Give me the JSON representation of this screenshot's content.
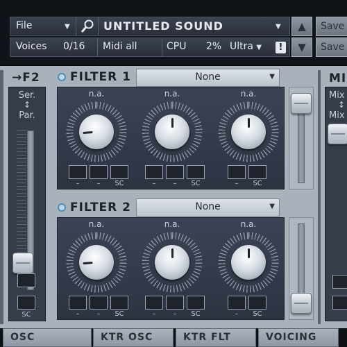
{
  "topbar": {
    "file_label": "File",
    "sound_name": "UNTITLED SOUND",
    "voices_label": "Voices",
    "voices_value": "0/16",
    "midi_label": "Midi all",
    "cpu_label": "CPU",
    "cpu_value": "2%",
    "quality_label": "Ultra",
    "warning_glyph": "!",
    "save_label": "Save",
    "save_label_2": "Save"
  },
  "f2panel": {
    "title": "→F2",
    "ser_label": "Ser.",
    "arrow": "↕",
    "par_label": "Par.",
    "sc_label": "SC",
    "level": 0.12
  },
  "filters": [
    {
      "title": "FILTER 1",
      "type": "None",
      "knobs": [
        {
          "label": "n.a.",
          "value": 0.15
        },
        {
          "label": "n.a.",
          "value": 0.5
        },
        {
          "label": "n.a.",
          "value": 0.5
        }
      ],
      "subs": [
        "–",
        "–",
        "SC",
        "–",
        "–",
        "SC",
        "–",
        "SC"
      ],
      "level": 0.95
    },
    {
      "title": "FILTER 2",
      "type": "None",
      "knobs": [
        {
          "label": "n.a.",
          "value": 0.15
        },
        {
          "label": "n.a.",
          "value": 0.5
        },
        {
          "label": "n.a.",
          "value": 0.5
        }
      ],
      "subs": [
        "–",
        "–",
        "SC",
        "–",
        "–",
        "SC",
        "–",
        "SC"
      ],
      "level": 0.05
    }
  ],
  "mixpanel": {
    "title": "MI",
    "mix_top": "Mix",
    "arrow": "↕",
    "mix_bottom": "Mix"
  },
  "tabs": [
    "OSC",
    "KTR OSC",
    "KTR FLT",
    "VOICING"
  ]
}
